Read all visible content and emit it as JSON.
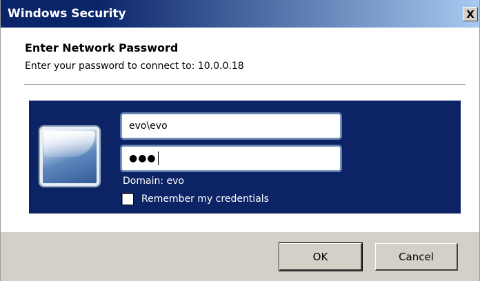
{
  "window": {
    "title": "Windows Security",
    "close_glyph": "X",
    "titlebar_colors": [
      "#0a246a",
      "#a6caf0"
    ]
  },
  "header": {
    "heading": "Enter Network Password",
    "subheading": "Enter your password to connect to: 10.0.0.18"
  },
  "credentials": {
    "panel_color": "#0c2366",
    "user_tile_icon": "user-tile-icon",
    "username_value": "evo\\evo",
    "password_mask": "●●●",
    "domain_text": "Domain: evo",
    "remember_label": "Remember my credentials",
    "remember_checked": false
  },
  "buttons": {
    "ok_label": "OK",
    "cancel_label": "Cancel"
  }
}
